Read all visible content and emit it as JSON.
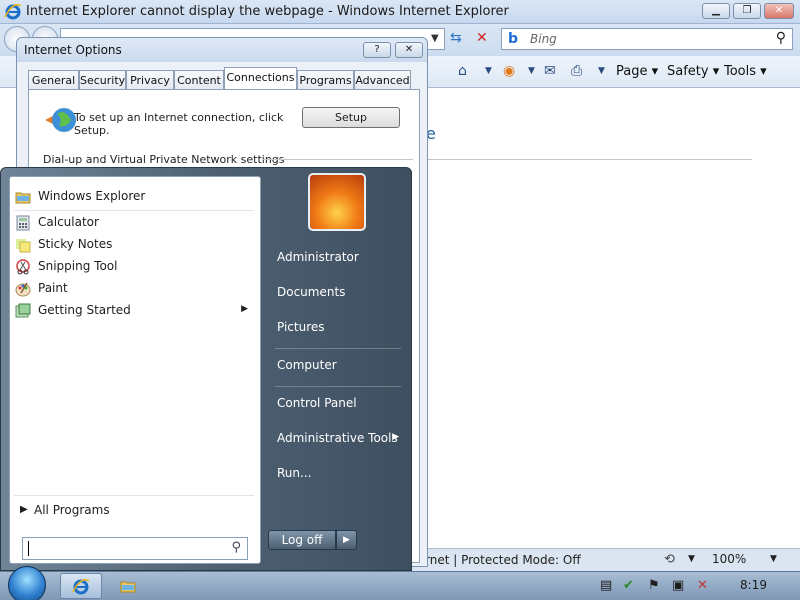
{
  "colors": {
    "accent": "#1f5d9e",
    "titlebar": "#cad9ee",
    "startmenu": "#4d6072",
    "taskbar": "#7f98b6"
  },
  "ie": {
    "title": "Internet Explorer cannot display the webpage - Windows Internet Explorer",
    "search_placeholder": "Bing",
    "cmd": {
      "page": "Page ▾",
      "safety": "Safety ▾",
      "tools": "Tools ▾"
    },
    "page_heading": "e",
    "status": {
      "text": "rnet | Protected Mode: Off",
      "zoom": "100%"
    }
  },
  "dialog": {
    "title": "Internet Options",
    "tabs": [
      "General",
      "Security",
      "Privacy",
      "Content",
      "Connections",
      "Programs",
      "Advanced"
    ],
    "active_tab": "Connections",
    "setup_text": "To set up an Internet connection, click Setup.",
    "setup_button": "Setup",
    "dialup_label": "Dial-up and Virtual Private Network settings"
  },
  "start_menu": {
    "pinned": [
      {
        "label": "Windows Explorer",
        "icon": "folder-icon"
      }
    ],
    "recent": [
      {
        "label": "Calculator",
        "icon": "calculator-icon"
      },
      {
        "label": "Sticky Notes",
        "icon": "sticky-notes-icon"
      },
      {
        "label": "Snipping Tool",
        "icon": "scissors-icon"
      },
      {
        "label": "Paint",
        "icon": "paint-palette-icon"
      },
      {
        "label": "Getting Started",
        "icon": "getting-started-icon",
        "submenu": true
      }
    ],
    "all_programs": "All Programs",
    "right": [
      {
        "label": "Administrator"
      },
      {
        "label": "Documents"
      },
      {
        "label": "Pictures"
      },
      {
        "label": "Computer"
      },
      {
        "label": "Control Panel"
      },
      {
        "label": "Administrative Tools",
        "submenu": true
      },
      {
        "label": "Run..."
      }
    ],
    "logoff": "Log off"
  },
  "taskbar": {
    "clock": "8:19"
  }
}
